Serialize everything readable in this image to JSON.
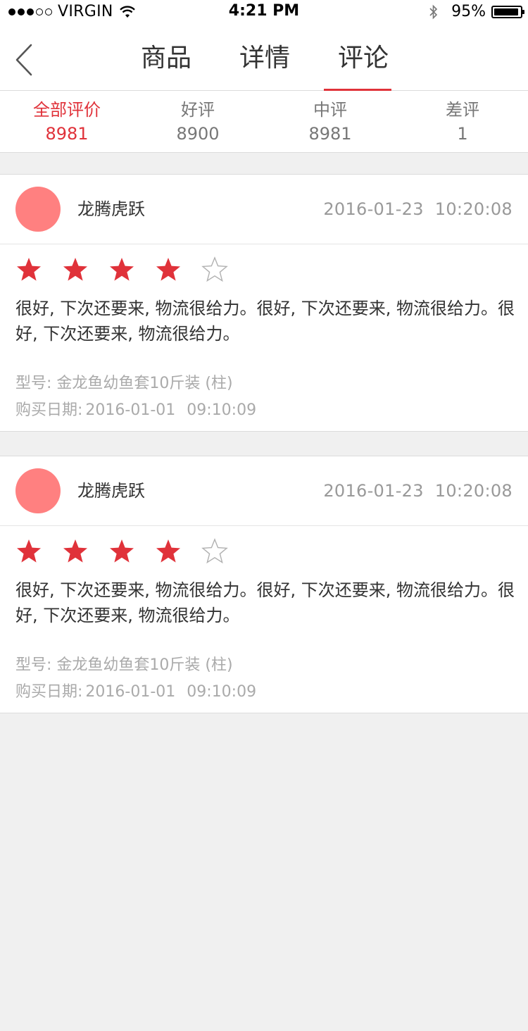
{
  "status_bar": {
    "carrier": "VIRGIN",
    "time": "4:21 PM",
    "battery_percent": "95%",
    "battery_level": 0.95,
    "signal_full": 3,
    "signal_empty": 2
  },
  "nav": {
    "tabs": [
      {
        "label": "商品",
        "active": false
      },
      {
        "label": "详情",
        "active": false
      },
      {
        "label": "评论",
        "active": true
      }
    ],
    "accent_color": "#e0323a"
  },
  "filters": [
    {
      "label": "全部评价",
      "count": "8981",
      "active": true
    },
    {
      "label": "好评",
      "count": "8900",
      "active": false
    },
    {
      "label": "中评",
      "count": "8981",
      "active": false
    },
    {
      "label": "差评",
      "count": "1",
      "active": false
    }
  ],
  "reviews": [
    {
      "user": "龙腾虎跃",
      "date": "2016-01-23",
      "time": "10:20:08",
      "rating": 4,
      "max_rating": 5,
      "text": "很好, 下次还要来, 物流很给力。很好, 下次还要来, 物流很给力。很好, 下次还要来, 物流很给力。",
      "model": "型号: 金龙鱼幼鱼套10斤装 (柱)",
      "purchase_label": "购买日期:",
      "purchase_date": "2016-01-01",
      "purchase_time": "09:10:09"
    },
    {
      "user": "龙腾虎跃",
      "date": "2016-01-23",
      "time": "10:20:08",
      "rating": 4,
      "max_rating": 5,
      "text": "很好, 下次还要来, 物流很给力。很好, 下次还要来, 物流很给力。很好, 下次还要来, 物流很给力。",
      "model": "型号: 金龙鱼幼鱼套10斤装 (柱)",
      "purchase_label": "购买日期:",
      "purchase_date": "2016-01-01",
      "purchase_time": "09:10:09"
    }
  ],
  "colors": {
    "star_filled": "#e0323a",
    "star_empty": "#b0b0b0",
    "avatar": "#ff8080"
  }
}
